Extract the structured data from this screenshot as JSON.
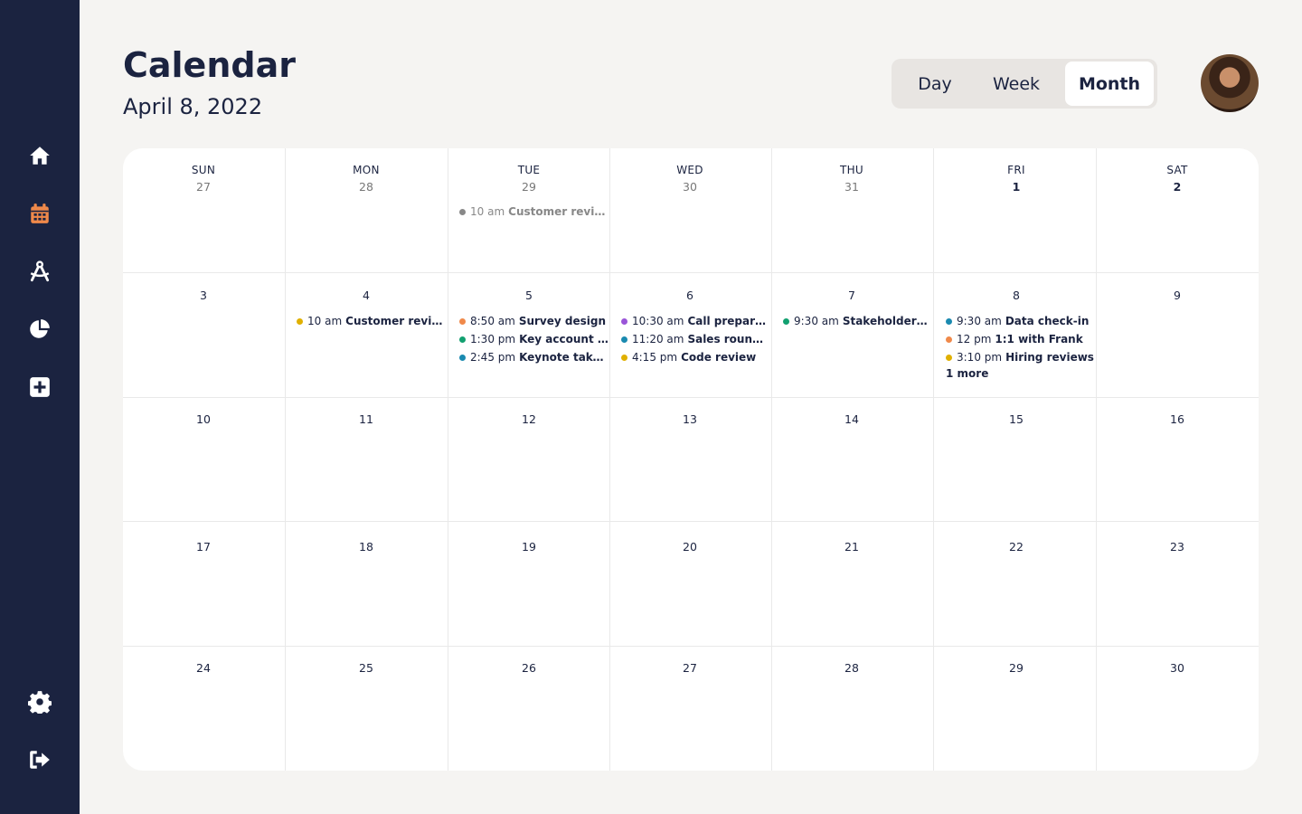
{
  "header": {
    "title": "Calendar",
    "date": "April 8, 2022"
  },
  "view_switch": {
    "options": [
      {
        "label": "Day",
        "active": false
      },
      {
        "label": "Week",
        "active": false
      },
      {
        "label": "Month",
        "active": true
      }
    ]
  },
  "sidebar": {
    "top_items": [
      {
        "icon": "home-icon",
        "active": false
      },
      {
        "icon": "calendar-icon",
        "active": true
      },
      {
        "icon": "compass-icon",
        "active": false
      },
      {
        "icon": "pie-chart-icon",
        "active": false
      },
      {
        "icon": "plus-square-icon",
        "active": false
      }
    ],
    "bottom_items": [
      {
        "icon": "gear-icon"
      },
      {
        "icon": "logout-icon"
      }
    ]
  },
  "colors": {
    "sidebar_bg": "#1b2340",
    "accent": "#f0894a",
    "event_gray": "#888888",
    "event_yellow": "#e0b000",
    "event_orange": "#f0894a",
    "event_green": "#12a070",
    "event_blue": "#1a8ab0",
    "event_purple": "#9a55d8"
  },
  "calendar": {
    "weekdays": [
      "SUN",
      "MON",
      "TUE",
      "WED",
      "THU",
      "FRI",
      "SAT"
    ],
    "weeks": [
      [
        "27",
        "28",
        "29",
        "30",
        "31",
        "1",
        "2"
      ],
      [
        "3",
        "4",
        "5",
        "6",
        "7",
        "8",
        "9"
      ],
      [
        "10",
        "11",
        "12",
        "13",
        "14",
        "15",
        "16"
      ],
      [
        "17",
        "18",
        "19",
        "20",
        "21",
        "22",
        "23"
      ],
      [
        "24",
        "25",
        "26",
        "27",
        "28",
        "29",
        "30"
      ]
    ],
    "events": {
      "w0_tue": [
        {
          "time": "10 am",
          "title": "Customer review",
          "color": "#888888"
        }
      ],
      "w1_mon": [
        {
          "time": "10 am",
          "title": "Customer review",
          "color": "#e0b000"
        }
      ],
      "w1_tue": [
        {
          "time": "8:50 am",
          "title": "Survey design",
          "color": "#f0894a"
        },
        {
          "time": "1:30 pm",
          "title": "Key account pl...",
          "color": "#12a070"
        },
        {
          "time": "2:45 pm",
          "title": "Keynote takea...",
          "color": "#1a8ab0"
        }
      ],
      "w1_wed": [
        {
          "time": "10:30 am",
          "title": "Call preparat...",
          "color": "#9a55d8"
        },
        {
          "time": "11:20 am",
          "title": "Sales round-...",
          "color": "#1a8ab0"
        },
        {
          "time": "4:15 pm",
          "title": "Code review",
          "color": "#e0b000"
        }
      ],
      "w1_thu": [
        {
          "time": "9:30 am",
          "title": "Stakeholders ...",
          "color": "#12a070"
        }
      ],
      "w1_fri": [
        {
          "time": "9:30 am",
          "title": "Data check-in",
          "color": "#1a8ab0"
        },
        {
          "time": "12 pm",
          "title": "1:1 with Frank",
          "color": "#f0894a"
        },
        {
          "time": "3:10 pm",
          "title": "Hiring reviews",
          "color": "#e0b000"
        }
      ],
      "w1_fri_more": "1 more"
    }
  }
}
